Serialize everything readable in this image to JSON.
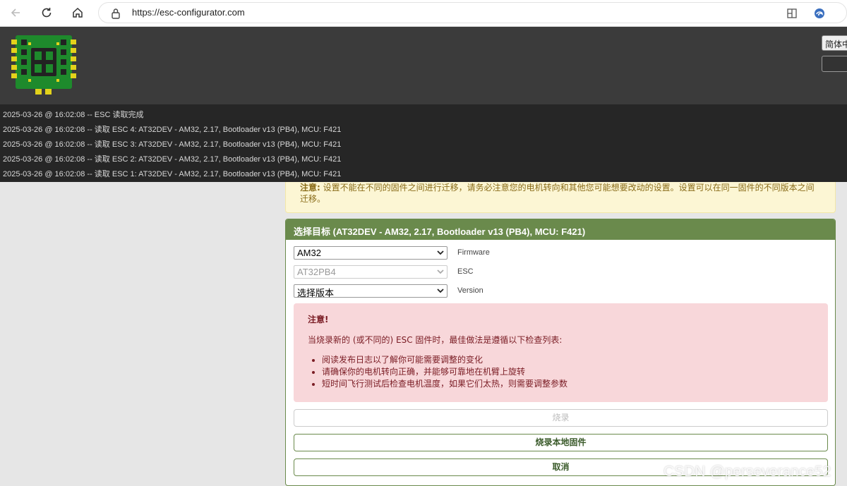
{
  "browser": {
    "url": "https://esc-configurator.com"
  },
  "header": {
    "language_label": "简体中文",
    "secondary_button_label": ""
  },
  "log": {
    "lines": [
      "2025-03-26 @ 16:02:08 -- ESC 读取完成",
      "2025-03-26 @ 16:02:08 -- 读取 ESC 4: AT32DEV - AM32, 2.17, Bootloader v13 (PB4), MCU: F421",
      "2025-03-26 @ 16:02:08 -- 读取 ESC 3: AT32DEV - AM32, 2.17, Bootloader v13 (PB4), MCU: F421",
      "2025-03-26 @ 16:02:08 -- 读取 ESC 2: AT32DEV - AM32, 2.17, Bootloader v13 (PB4), MCU: F421",
      "2025-03-26 @ 16:02:08 -- 读取 ESC 1: AT32DEV - AM32, 2.17, Bootloader v13 (PB4), MCU: F421"
    ]
  },
  "note": {
    "label": "注意:",
    "text": "设置不能在不同的固件之间进行迁移，请务必注意您的电机转向和其他您可能想要改动的设置。设置可以在同一固件的不同版本之间迁移。"
  },
  "panel": {
    "title": "选择目标 (AT32DEV - AM32, 2.17, Bootloader v13 (PB4), MCU: F421)",
    "firmware": {
      "value": "AM32",
      "label": "Firmware"
    },
    "esc": {
      "value": "AT32PB4",
      "label": "ESC"
    },
    "version": {
      "value": "选择版本",
      "label": "Version"
    },
    "warning": {
      "title": "注意!",
      "intro": "当烧录新的 (或不同的) ESC 固件时，最佳做法是遵循以下检查列表:",
      "items": [
        "阅读发布日志以了解你可能需要调整的变化",
        "请确保你的电机转向正确，并能够可靠地在机臂上旋转",
        "短时间飞行测试后检查电机温度，如果它们太热，则需要调整参数"
      ]
    },
    "buttons": {
      "flash": "烧录",
      "flash_local": "烧录本地固件",
      "cancel": "取消"
    }
  },
  "watermark": "CSDN @perseverance52",
  "colors": {
    "panel_accent": "#6a8a4c",
    "warning_bg": "#f8d7da",
    "note_bg": "#fcf6d4",
    "header_bg": "#3b3b3b",
    "log_bg": "#262626"
  }
}
